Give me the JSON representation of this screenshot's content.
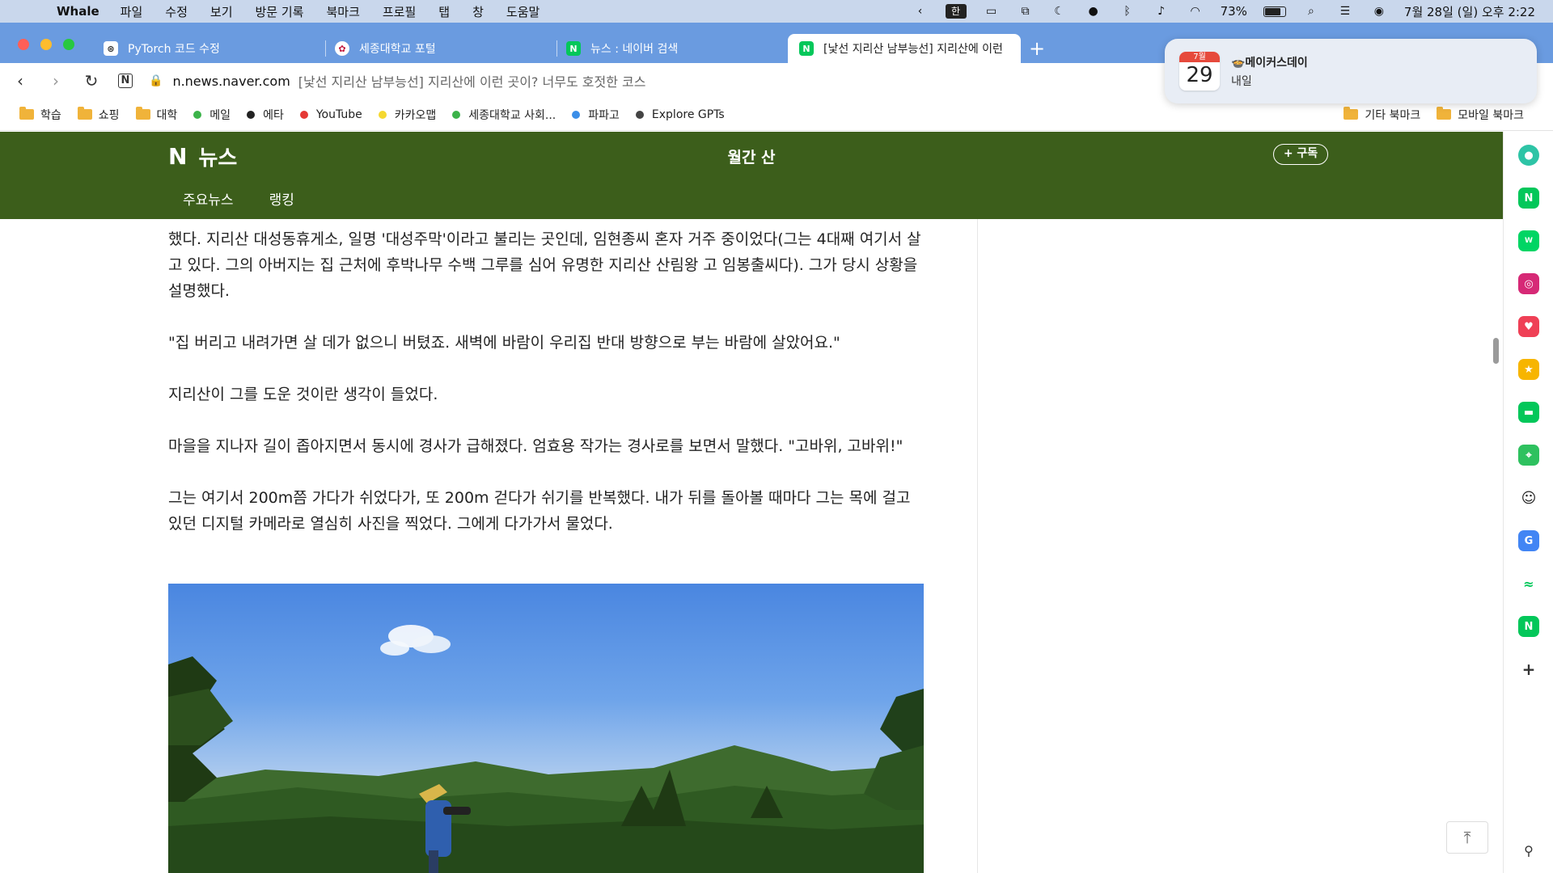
{
  "menubar": {
    "apple": "",
    "app_name": "Whale",
    "items": [
      "파일",
      "수정",
      "보기",
      "방문 기록",
      "북마크",
      "프로필",
      "탭",
      "창",
      "도움말"
    ],
    "ime": "한",
    "battery": "73%",
    "battery_level": 0.73,
    "datetime": "7월 28일 (일) 오후 2:22"
  },
  "tabs": [
    {
      "title": "PyTorch 코드 수정",
      "icon": "chatgpt-icon"
    },
    {
      "title": "세종대학교 포털",
      "icon": "sejong-icon"
    },
    {
      "title": "뉴스 : 네이버 검색",
      "icon": "naver-icon"
    },
    {
      "title": "[낯선 지리산 남부능선] 지리산에 이런",
      "icon": "naver-icon",
      "active": true
    }
  ],
  "address": {
    "domain": "n.news.naver.com",
    "title": "[낯선 지리산 남부능선] 지리산에 이런 곳이? 너무도 호젓한 코스"
  },
  "bookmarks": [
    {
      "label": "학습",
      "type": "folder"
    },
    {
      "label": "쇼핑",
      "type": "folder"
    },
    {
      "label": "대학",
      "type": "folder"
    },
    {
      "label": "메일",
      "type": "dot",
      "color": "#3cb34a"
    },
    {
      "label": "에타",
      "type": "dot",
      "color": "#222222"
    },
    {
      "label": "YouTube",
      "type": "dot",
      "color": "#e53935"
    },
    {
      "label": "카카오맵",
      "type": "dot",
      "color": "#f5d830"
    },
    {
      "label": "세종대학교 사회...",
      "type": "dot",
      "color": "#3cb34a"
    },
    {
      "label": "파파고",
      "type": "dot",
      "color": "#3b8ee8"
    },
    {
      "label": "Explore GPTs",
      "type": "dot",
      "color": "#444444"
    }
  ],
  "bookmarks_right": [
    "기타 북마크",
    "모바일 북마크"
  ],
  "notification": {
    "month": "7월",
    "day": "29",
    "title": "🍲메이커스데이",
    "subtitle": "내일"
  },
  "news": {
    "logo": "뉴스",
    "press": "월간 산",
    "subscribe": "+ 구독",
    "nav": [
      "주요뉴스",
      "랭킹"
    ]
  },
  "article": {
    "paragraphs": [
      "했다. 지리산 대성동휴게소, 일명 '대성주막'이라고 불리는 곳인데, 임현종씨 혼자 거주 중이었다(그는 4대째 여기서 살고 있다. 그의 아버지는 집 근처에 후박나무 수백 그루를 심어 유명한 지리산 산림왕 고 임봉출씨다). 그가 당시 상황을 설명했다.",
      "\"집 버리고 내려가면 살 데가 없으니 버텼죠. 새벽에 바람이 우리집 반대 방향으로 부는 바람에 살았어요.\"",
      "지리산이 그를 도운 것이란 생각이 들었다.",
      "마을을 지나자 길이 좁아지면서 동시에 경사가 급해졌다. 엄효용 작가는 경사로를 보면서 말했다. \"고바위, 고바위!\"",
      "그는 여기서 200m쯤 가다가 쉬었다가, 또 200m 걷다가 쉬기를 반복했다. 내가 뒤를 돌아볼 때마다 그는 목에 걸고 있던 디지털 카메라로 열심히 사진을 찍었다. 그에게 다가가서 물었다."
    ]
  },
  "sidebar_icons": [
    {
      "name": "whale-space-icon",
      "color": "#2ec4a6"
    },
    {
      "name": "naver-icon",
      "color": "#03c75a"
    },
    {
      "name": "webtoon-icon",
      "color": "#00d564"
    },
    {
      "name": "instagram-icon",
      "color": "#d62976"
    },
    {
      "name": "pocket-icon",
      "color": "#ef4056"
    },
    {
      "name": "favorites-icon",
      "color": "#f7b500"
    },
    {
      "name": "pay-icon",
      "color": "#03c75a"
    },
    {
      "name": "map-icon",
      "color": "#2ec15f"
    },
    {
      "name": "smile-icon",
      "color": "#222222"
    },
    {
      "name": "translate-icon",
      "color": "#4285f4"
    },
    {
      "name": "stock-icon",
      "color": "#03c75a"
    },
    {
      "name": "shopping-icon",
      "color": "#03c75a"
    },
    {
      "name": "add-icon",
      "color": "#333333"
    },
    {
      "name": "pin-icon",
      "color": "#333333"
    }
  ]
}
